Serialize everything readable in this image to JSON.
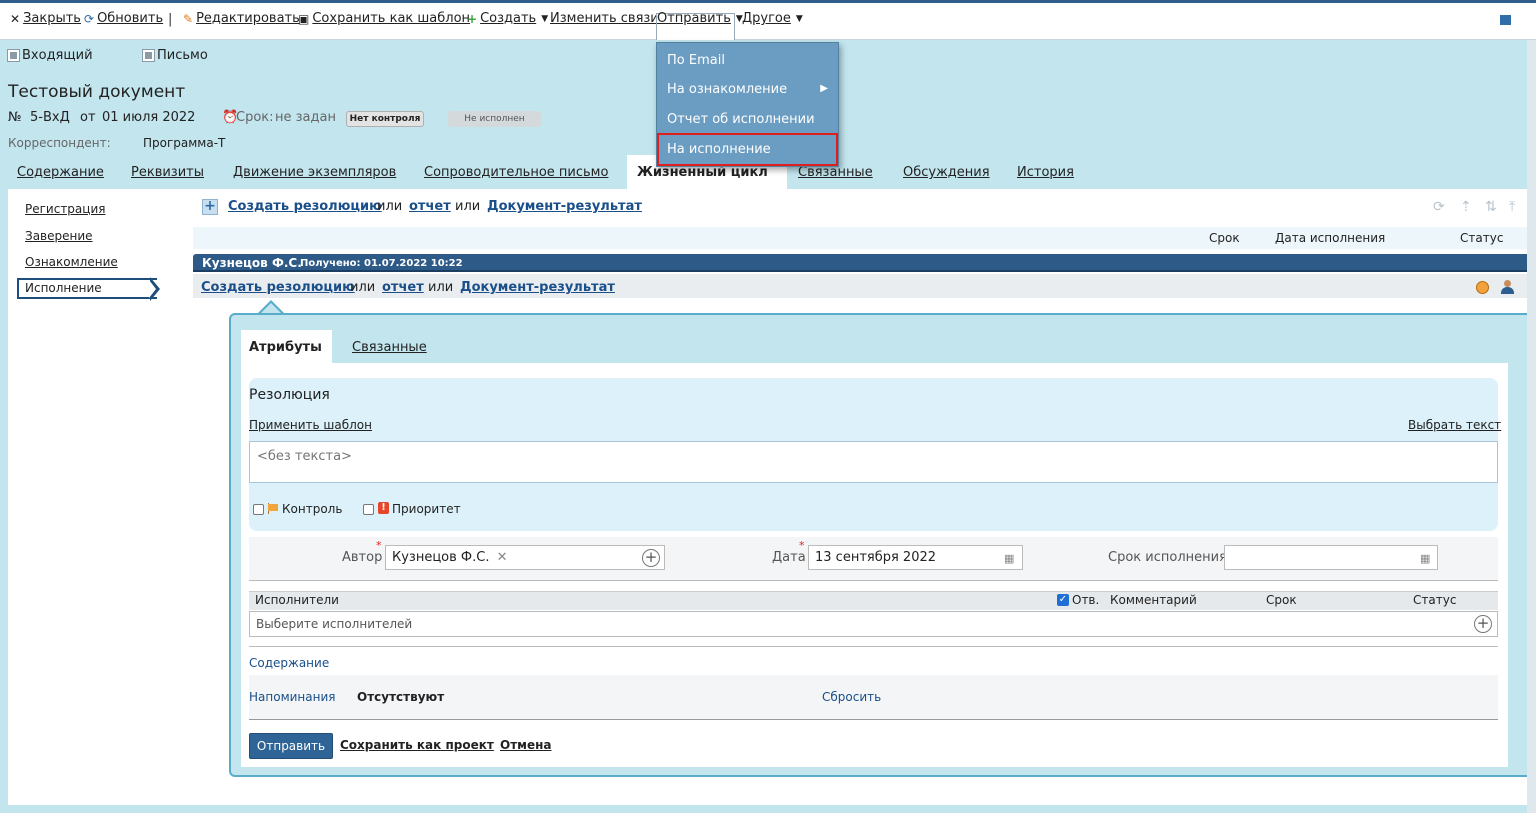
{
  "toolbar": {
    "close": "Закрыть",
    "refresh": "Обновить",
    "separator": "|",
    "edit": "Редактировать",
    "save_template": "Сохранить как шаблон",
    "create": "Создать",
    "change_links": "Изменить связи",
    "send": "Отправить",
    "other": "Другое"
  },
  "send_menu": {
    "items": [
      "По Email",
      "На ознакомление",
      "Отчет об исполнении",
      "На исполнение"
    ]
  },
  "doc": {
    "type_tag": "Входящий",
    "kind_tag": "Письмо",
    "title": "Тестовый документ",
    "number_label": "№",
    "number": "5-ВхД",
    "date_label": "от",
    "date": "01 июля 2022",
    "deadline_label": "Срок:",
    "deadline": "не задан",
    "control_badge": "Нет контроля",
    "status_badge": "Не исполнен",
    "correspondent_label": "Корреспондент:",
    "correspondent": "Программа-Т"
  },
  "tabs": [
    "Содержание",
    "Реквизиты",
    "Движение экземпляров",
    "Сопроводительное письмо",
    "Жизненный цикл",
    "Связанные",
    "Обсуждения",
    "История"
  ],
  "sidebar": [
    "Регистрация",
    "Заверение",
    "Ознакомление",
    "Исполнение"
  ],
  "actions": {
    "create_resolution": "Создать резолюцию",
    "or": "или",
    "report": "отчет",
    "result_doc": "Документ-результат"
  },
  "columns": {
    "deadline": "Срок",
    "exec_date": "Дата исполнения",
    "status": "Статус"
  },
  "assignee": {
    "name": "Кузнецов Ф.С.",
    "received": "Получено: 01.07.2022 10:22"
  },
  "form": {
    "tab_attributes": "Атрибуты",
    "tab_related": "Связанные",
    "resolution_title": "Резолюция",
    "apply_template": "Применить шаблон",
    "choose_text": "Выбрать текст",
    "text_placeholder": "<без текста>",
    "control_label": "Контроль",
    "priority_label": "Приоритет",
    "author_label": "Автор",
    "author_value": "Кузнецов Ф.С.",
    "date_label": "Дата",
    "date_value": "13 сентября 2022",
    "exec_deadline_label": "Срок исполнения",
    "executors_label": "Исполнители",
    "resp_label": "Отв.",
    "comment_label": "Комментарий",
    "deadline_col": "Срок",
    "status_col": "Статус",
    "executors_placeholder": "Выберите исполнителей",
    "content_label": "Содержание",
    "reminders_label": "Напоминания",
    "reminders_value": "Отсутствуют",
    "reset": "Сбросить",
    "send_button": "Отправить",
    "save_draft": "Сохранить как проект",
    "cancel": "Отмена"
  }
}
